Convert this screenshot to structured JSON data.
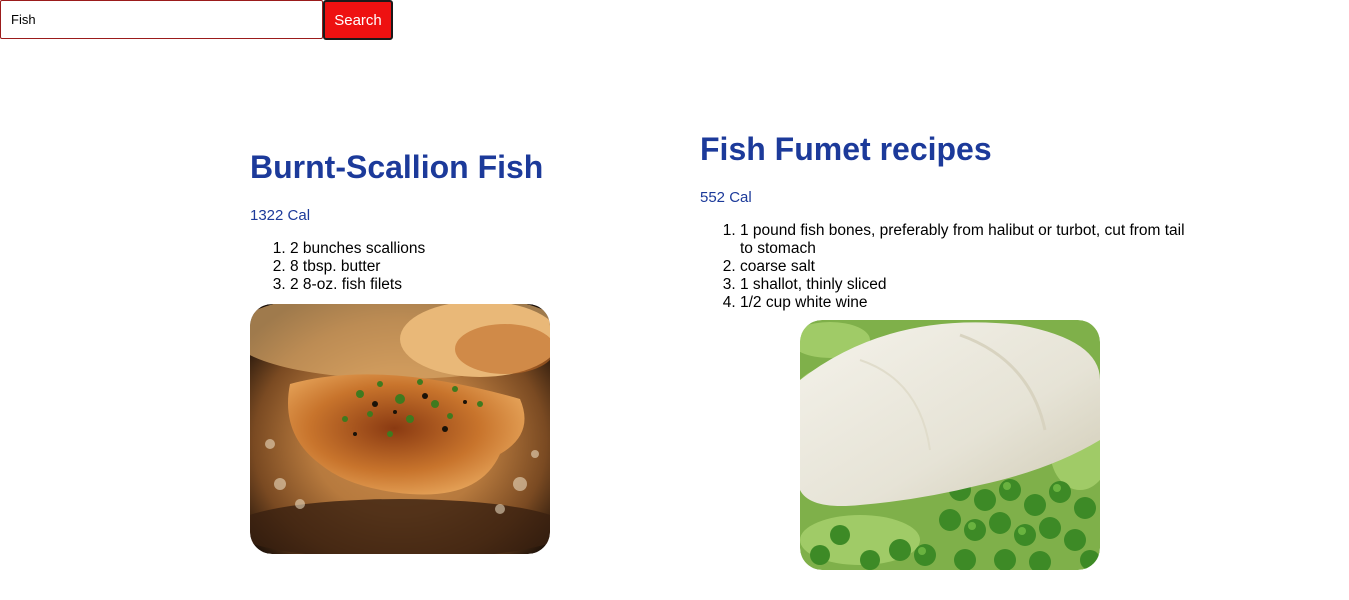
{
  "search": {
    "value": "Fish",
    "button_label": "Search"
  },
  "recipes": [
    {
      "title": "Burnt-Scallion Fish",
      "calories": "1322 Cal",
      "ingredients": [
        "2 bunches scallions",
        "8 tbsp. butter",
        "2 8-oz. fish filets"
      ]
    },
    {
      "title": "Fish Fumet recipes",
      "calories": "552 Cal",
      "ingredients": [
        "1 pound fish bones, preferably from halibut or turbot, cut from tail to stomach",
        "coarse salt",
        "1 shallot, thinly sliced",
        "1/2 cup white wine"
      ]
    }
  ],
  "colors": {
    "accent": "#1c3a9a",
    "search_button": "#ee1111",
    "search_border": "#9b1b1b"
  }
}
